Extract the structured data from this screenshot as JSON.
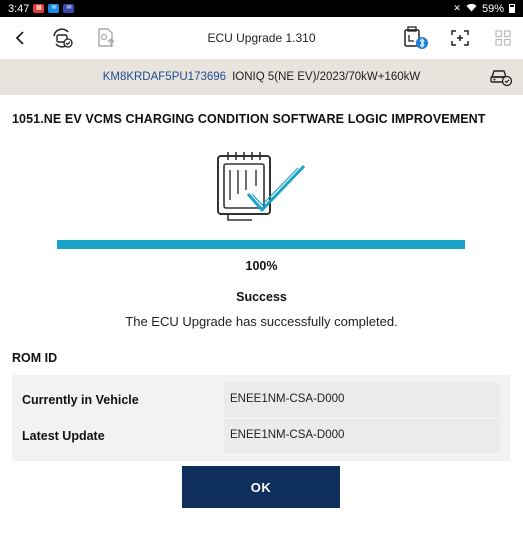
{
  "status_bar": {
    "time": "3:47",
    "battery": "59%",
    "notification_icons": [
      "calendar-icon",
      "message-icon",
      "chat-icon"
    ]
  },
  "toolbar": {
    "title": "ECU Upgrade 1.310",
    "back_icon": "chevron-left-icon",
    "icons": [
      "vehicle-scan-icon",
      "file-upload-icon",
      "vci-bluetooth-icon",
      "screenshot-icon",
      "grid-icon"
    ]
  },
  "vehicle": {
    "vin": "KM8KRDAF5PU173696",
    "model": "IONIQ 5(NE EV)/2023/70kW+160kW"
  },
  "upgrade": {
    "title": "1051.NE EV VCMS CHARGING CONDITION SOFTWARE LOGIC IMPROVEMENT",
    "progress_fraction": 1.0,
    "progress_text": "100%",
    "status": "Success",
    "message": "The ECU Upgrade has successfully completed."
  },
  "rom": {
    "title": "ROM ID",
    "rows": [
      {
        "label": "Currently in Vehicle",
        "value": "ENEE1NM-CSA-D000"
      },
      {
        "label": "Latest Update",
        "value": "ENEE1NM-CSA-D000"
      }
    ]
  },
  "actions": {
    "ok_label": "OK"
  },
  "colors": {
    "accent": "#1aa3c8",
    "primary_button": "#0e2e5c",
    "vin_text": "#1d4f91",
    "vehicle_bar": "#e8e3dc"
  }
}
